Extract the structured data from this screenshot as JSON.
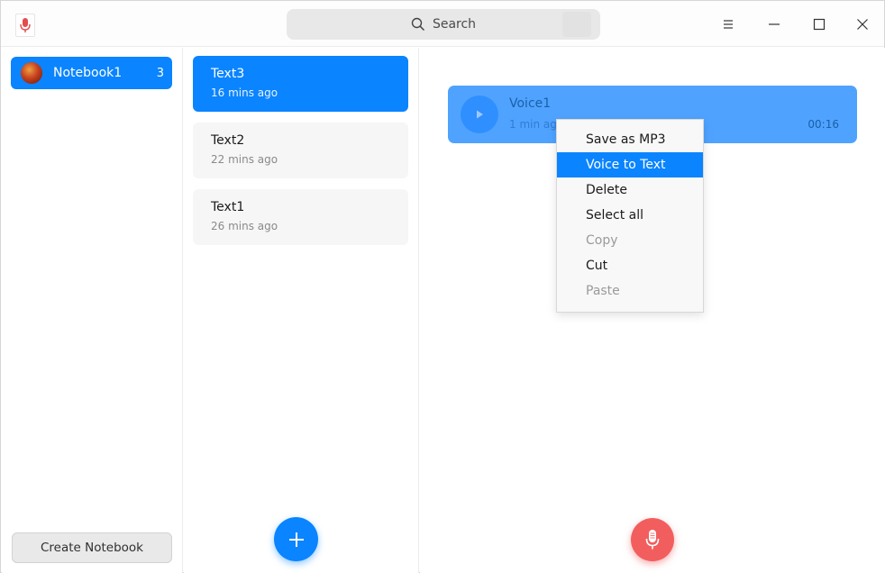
{
  "titlebar": {
    "search_placeholder": "Search"
  },
  "sidebar": {
    "notebooks": [
      {
        "label": "Notebook1",
        "count": "3"
      }
    ],
    "create_button": "Create Notebook"
  },
  "notes": [
    {
      "title": "Text3",
      "time": "16 mins ago",
      "selected": true
    },
    {
      "title": "Text2",
      "time": "22 mins ago",
      "selected": false
    },
    {
      "title": "Text1",
      "time": "26 mins ago",
      "selected": false
    }
  ],
  "detail": {
    "voice": {
      "title": "Voice1",
      "time": "1 min ago",
      "duration": "00:16"
    }
  },
  "context_menu": {
    "items": [
      {
        "label": "Save as MP3",
        "state": "normal"
      },
      {
        "label": "Voice to Text",
        "state": "active"
      },
      {
        "label": "Delete",
        "state": "normal"
      },
      {
        "label": "Select all",
        "state": "normal"
      },
      {
        "label": "Copy",
        "state": "disabled"
      },
      {
        "label": "Cut",
        "state": "normal"
      },
      {
        "label": "Paste",
        "state": "disabled"
      }
    ]
  },
  "colors": {
    "accent": "#0a84ff",
    "voice_card": "#4fa3ff",
    "record": "#f25e5e"
  },
  "icons": {
    "app": "microphone-app-icon",
    "search": "search-icon",
    "menu": "hamburger-icon",
    "minimize": "minimize-icon",
    "maximize": "maximize-icon",
    "close": "close-icon",
    "add": "plus-icon",
    "play": "play-icon",
    "record": "microphone-icon"
  }
}
